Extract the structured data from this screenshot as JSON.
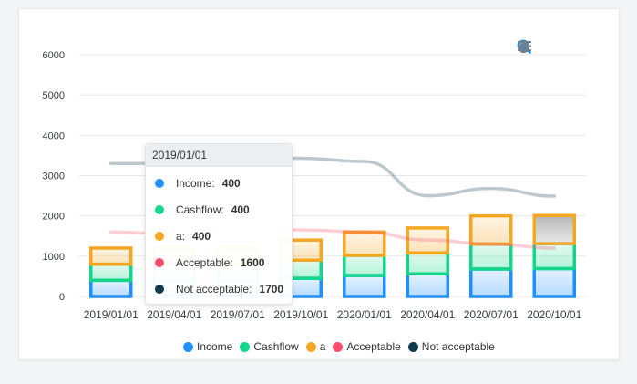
{
  "chart_data": {
    "type": "bar",
    "categories": [
      "2019/01/01",
      "2019/04/01",
      "2019/07/01",
      "2019/10/01",
      "2020/01/01",
      "2020/04/01",
      "2020/07/01",
      "2020/10/01"
    ],
    "y_ticks": [
      0,
      1000,
      2000,
      3000,
      4000,
      5000,
      6000
    ],
    "ylim": [
      0,
      6000
    ],
    "series": [
      {
        "name": "Income",
        "type": "bar",
        "color": "#1e90ff",
        "values": [
          400,
          400,
          400,
          450,
          520,
          560,
          680,
          690
        ]
      },
      {
        "name": "Cashflow",
        "type": "bar",
        "color": "#13d68b",
        "values": [
          400,
          400,
          400,
          450,
          500,
          520,
          620,
          620
        ]
      },
      {
        "name": "a",
        "type": "bar",
        "color": "#f5a623",
        "values": [
          400,
          400,
          400,
          500,
          580,
          620,
          700,
          700
        ]
      },
      {
        "name": "Acceptable",
        "type": "line",
        "color": "#ff4d6d",
        "values": [
          1600,
          1550,
          1700,
          1650,
          1600,
          1400,
          1300,
          1200
        ]
      },
      {
        "name": "Not acceptable",
        "type": "line",
        "color": "#0f3b4c",
        "values": [
          3300,
          3300,
          3400,
          3430,
          3350,
          2500,
          2680,
          2490
        ]
      }
    ],
    "grid": true,
    "legend_position": "bottom-center",
    "tooltip": {
      "title": "2019/01/01",
      "items": [
        {
          "name": "Income",
          "value": "400",
          "color": "#1e90ff"
        },
        {
          "name": "Cashflow",
          "value": "400",
          "color": "#13d68b"
        },
        {
          "name": "a",
          "value": "400",
          "color": "#f5a623"
        },
        {
          "name": "Acceptable",
          "value": "1600",
          "color": "#ff4d6d"
        },
        {
          "name": "Not acceptable",
          "value": "1700",
          "color": "#0f3b4c"
        }
      ]
    }
  },
  "toolbar": {
    "buttons": [
      "zoom-in-icon",
      "zoom-out-icon",
      "selection-zoom-icon",
      "pan-hand-icon",
      "reset-home-icon",
      "menu-icon"
    ]
  }
}
